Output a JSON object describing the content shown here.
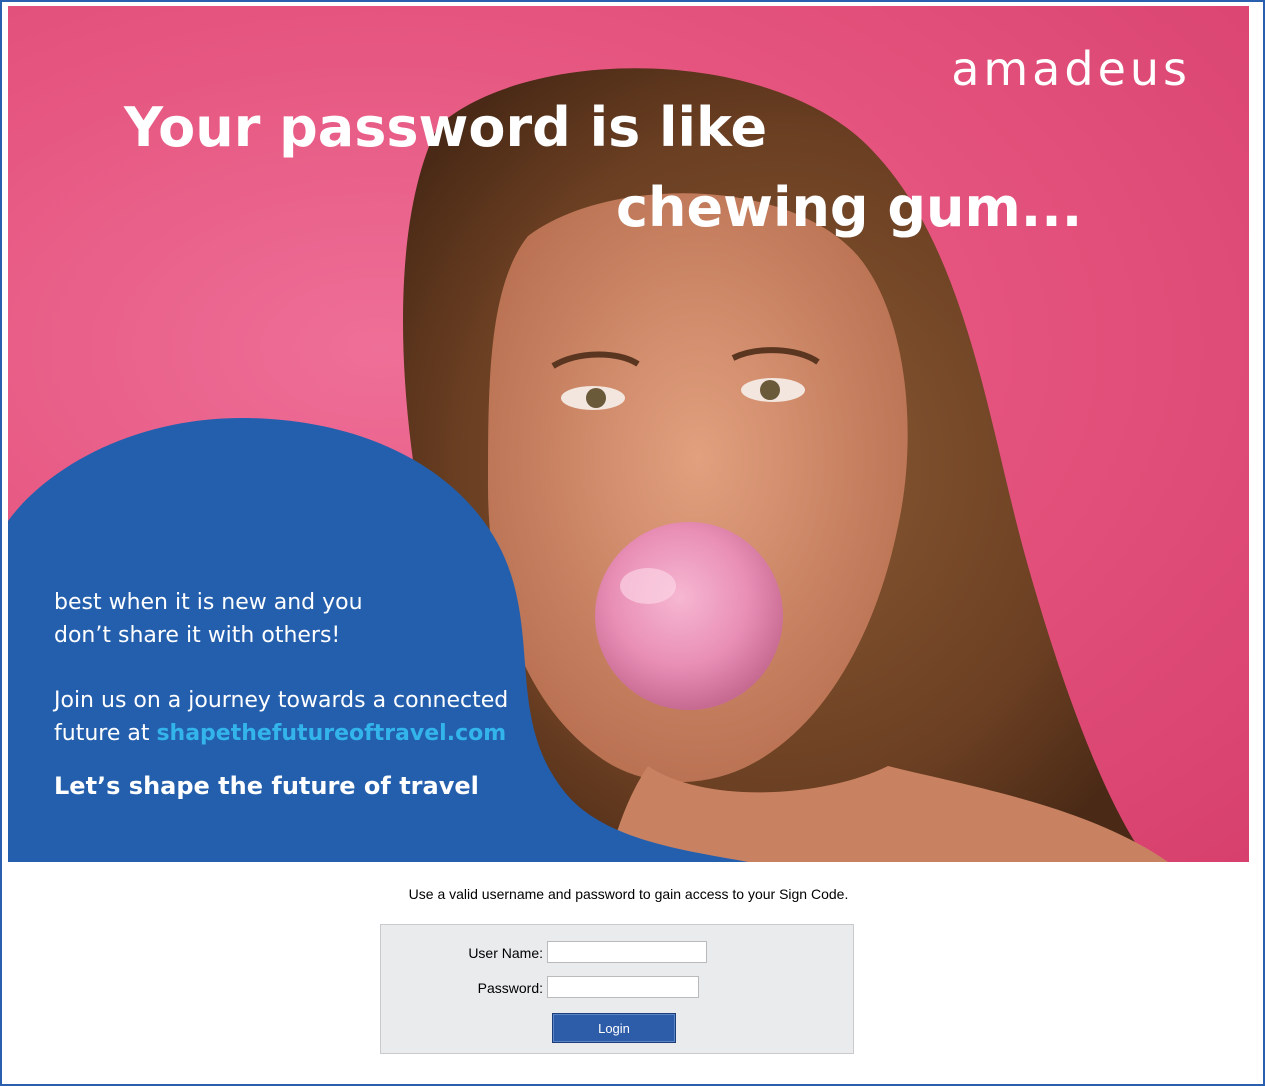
{
  "banner": {
    "brand": "amadeus",
    "headline_line1": "Your password is like",
    "headline_line2": "chewing gum...",
    "message_line1": "best when it is new and you",
    "message_line2": "don’t share it with others!",
    "join_line1": "Join us on a journey towards a connected",
    "join_prefix": "future at ",
    "link_text": "shapethefutureoftravel.com",
    "cta": "Let’s shape the future of travel",
    "colors": {
      "pink": "#e5557f",
      "blue": "#245fad",
      "link": "#33b4ea"
    }
  },
  "login": {
    "instruction": "Use a valid username and password to gain access to your Sign Code.",
    "username_label": "User Name:",
    "username_value": "",
    "password_label": "Password:",
    "password_value": "",
    "button_label": "Login"
  }
}
